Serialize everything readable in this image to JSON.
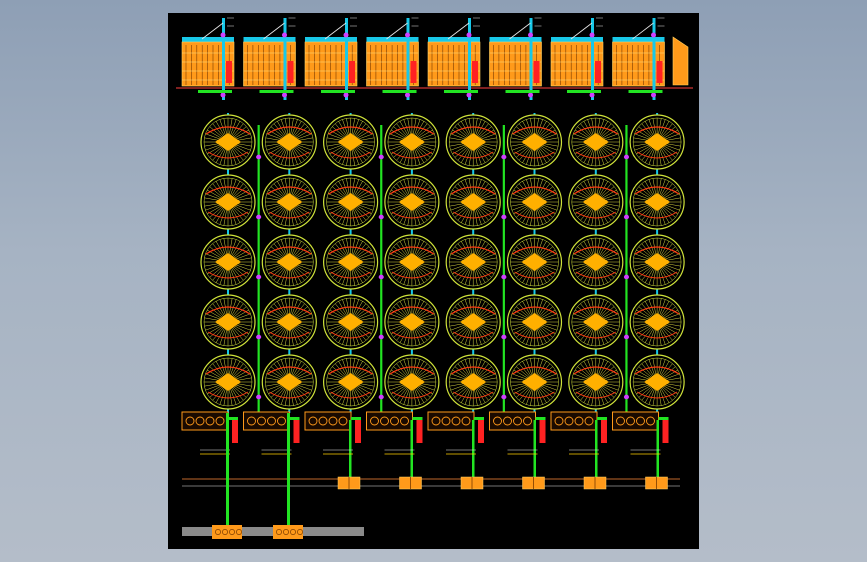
{
  "viewer": {
    "background_top": "#8e9fb5",
    "background_bottom": "#b4bdc9",
    "canvas_color": "#000000"
  },
  "drawing": {
    "silo_grid": {
      "rows": 5,
      "cols": 8
    },
    "elevation_units": 8,
    "bottom_unit_count": 8,
    "colors": {
      "circle_outline": "#cfe23a",
      "circle_fill": "#ffb000",
      "spoke": "#f2ee4a",
      "hatch": "#ff3a12",
      "conveyor_green": "#22e422",
      "conveyor_cyan": "#18c8e8",
      "node_magenta": "#d040ff",
      "building_orange": "#ff9a1a",
      "building_red": "#ff2222",
      "dim_white": "#e8e8e8"
    }
  }
}
